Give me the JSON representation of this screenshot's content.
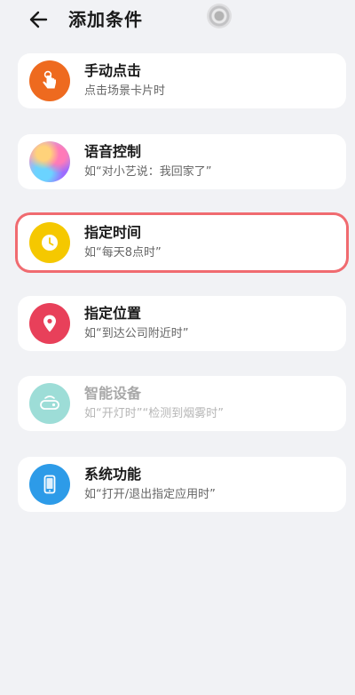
{
  "header": {
    "title": "添加条件",
    "back_icon": "arrow-left-icon"
  },
  "conditions": [
    {
      "title": "手动点击",
      "subtitle": "点击场景卡片时",
      "icon": "hand-tap-icon",
      "color": "#ee6a1f",
      "highlighted": false,
      "disabled": false
    },
    {
      "title": "语音控制",
      "subtitle": "如“对小艺说：我回家了”",
      "icon": "voice-assistant-icon",
      "color": "#9b7bf0",
      "highlighted": false,
      "disabled": false
    },
    {
      "title": "指定时间",
      "subtitle": "如“每天8点时”",
      "icon": "clock-icon",
      "color": "#f5c800",
      "highlighted": true,
      "disabled": false
    },
    {
      "title": "指定位置",
      "subtitle": "如“到达公司附近时”",
      "icon": "location-pin-icon",
      "color": "#e8405a",
      "highlighted": false,
      "disabled": false
    },
    {
      "title": "智能设备",
      "subtitle": "如“开灯时”“检测到烟雾时”",
      "icon": "smart-device-icon",
      "color": "#27b4a8",
      "highlighted": false,
      "disabled": true
    },
    {
      "title": "系统功能",
      "subtitle": "如“打开/退出指定应用时”",
      "icon": "phone-icon",
      "color": "#2d9be8",
      "highlighted": false,
      "disabled": false
    }
  ],
  "colors": {
    "background": "#f1f2f5",
    "card": "#ffffff",
    "highlight_border": "#f06b70"
  }
}
